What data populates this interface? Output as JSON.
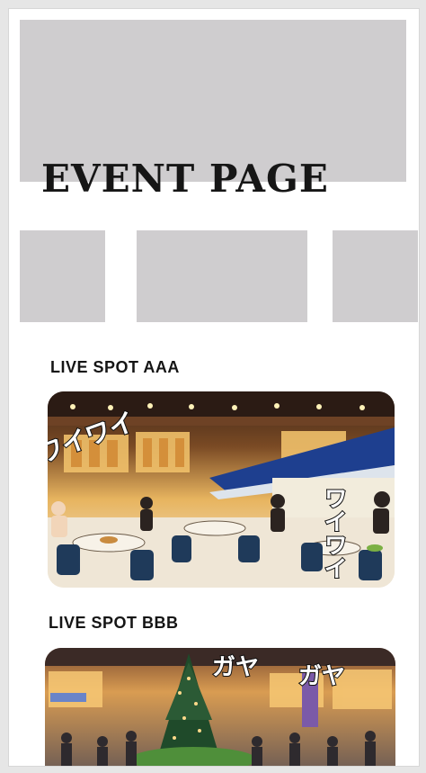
{
  "page": {
    "title": "EVENT PAGE"
  },
  "spots": [
    {
      "title": "LIVE SPOT AAA",
      "image_text_1": "ワイワイ",
      "image_text_2": "ワイワイ"
    },
    {
      "title": "LIVE SPOT BBB",
      "image_text_1": "ガヤ",
      "image_text_2": "ガヤ"
    }
  ],
  "colors": {
    "page_bg": "#e6e6e6",
    "card_bg": "#ffffff",
    "placeholder": "#cfcdcf",
    "text": "#151515"
  }
}
